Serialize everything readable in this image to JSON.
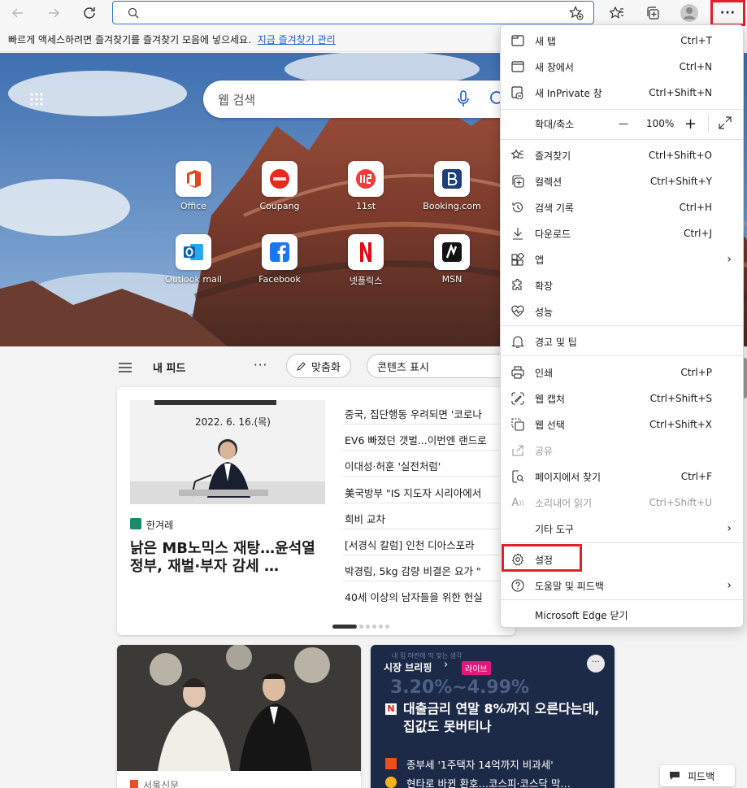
{
  "toolbar": {
    "address_value": "",
    "more_label": "···"
  },
  "favbar": {
    "text": "빠르게 액세스하려면 즐겨찾기를 즐겨찾기 모음에 넣으세요.",
    "link": "지금 즐겨찾기 관리"
  },
  "newtab": {
    "search_placeholder": "웹 검색",
    "tiles": [
      {
        "label": "Office"
      },
      {
        "label": "Coupang"
      },
      {
        "label": "11st"
      },
      {
        "label": "Booking.com"
      },
      {
        "label": "Outlook mail"
      },
      {
        "label": "Facebook"
      },
      {
        "label": "넷플릭스"
      },
      {
        "label": "MSN"
      }
    ],
    "feed_title": "내 피드",
    "personalize": "맞춤화",
    "content_display": "콘텐츠 표시"
  },
  "news": {
    "image_caption": "2022. 6. 16.(목)",
    "source": "한겨레",
    "main_title": "낡은 MB노믹스 재탕…윤석열 정부, 재벌·부자 감세 …",
    "headlines": [
      "중국, 집단행동 우려되면 '코로나",
      "EV6 빠졌던 갯벌...이번엔 랜드로",
      "이대성·허훈 '실전처럼'",
      "美국방부 \"IS 지도자 시리아에서",
      "희비 교차",
      "[서경식 칼럼] 인천 디아스포라",
      "박경림, 5kg 감량 비결은 요가 \"",
      "40세 이상의 남자들을 위한 헌실"
    ],
    "card2_source": "서울신문",
    "market_label": "시장 브리핑",
    "live_badge": "라이브",
    "bg_numbers": "3.20%∼4.99%",
    "bg_small": "내 집 마련에 딱 맞는 생각",
    "card3_title": "대출금리 연말 8%까지 오른다는데, 집값도 못버티나",
    "card3_item1": "종부세 '1주택자 14억까지 비과세'",
    "card3_item2": "현타로 바뀐 환호…코스피·코스닥 막…",
    "feedback_label": "피드백"
  },
  "menu": {
    "new_tab": {
      "label": "새 탭",
      "shortcut": "Ctrl+T"
    },
    "new_window": {
      "label": "새 창에서",
      "shortcut": "Ctrl+N"
    },
    "new_inprivate": {
      "label": "새 InPrivate 창",
      "shortcut": "Ctrl+Shift+N"
    },
    "zoom": {
      "label": "확대/축소",
      "value": "100%",
      "minus": "—",
      "plus": "+"
    },
    "favorites": {
      "label": "즐겨찾기",
      "shortcut": "Ctrl+Shift+O"
    },
    "collections": {
      "label": "컬렉션",
      "shortcut": "Ctrl+Shift+Y"
    },
    "history": {
      "label": "검색 기록",
      "shortcut": "Ctrl+H"
    },
    "downloads": {
      "label": "다운로드",
      "shortcut": "Ctrl+J"
    },
    "apps": {
      "label": "앱"
    },
    "extensions": {
      "label": "확장"
    },
    "performance": {
      "label": "성능"
    },
    "alerts": {
      "label": "경고 및 팁"
    },
    "print": {
      "label": "인쇄",
      "shortcut": "Ctrl+P"
    },
    "web_capture": {
      "label": "웹 캡처",
      "shortcut": "Ctrl+Shift+S"
    },
    "web_select": {
      "label": "웹 선택",
      "shortcut": "Ctrl+Shift+X"
    },
    "share": {
      "label": "공유"
    },
    "find": {
      "label": "페이지에서 찾기",
      "shortcut": "Ctrl+F"
    },
    "read_aloud": {
      "label": "소리내어 읽기",
      "shortcut": "Ctrl+Shift+U"
    },
    "more_tools": {
      "label": "기타 도구"
    },
    "settings": {
      "label": "설정"
    },
    "help": {
      "label": "도움말 및 피드백"
    },
    "close": {
      "label": "Microsoft Edge 닫기"
    }
  },
  "colors": {
    "accent": "#1a5ec9",
    "highlight": "#e0202b"
  }
}
